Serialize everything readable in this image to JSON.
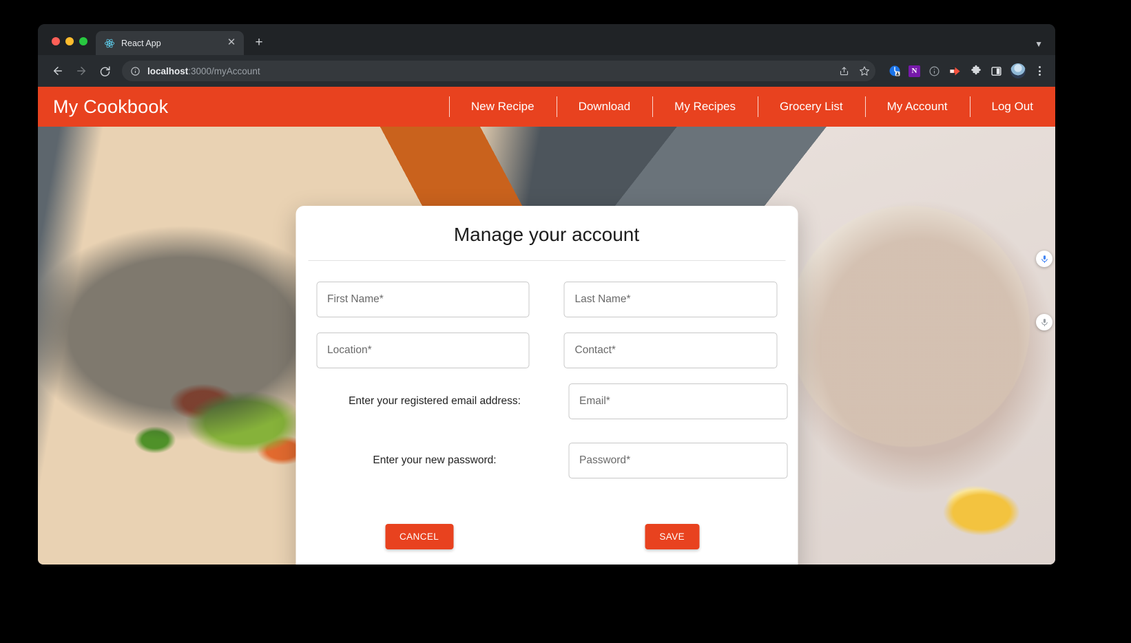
{
  "browser": {
    "tab": {
      "title": "React App",
      "favicon_icon": "react-logo-icon",
      "close_icon": "close-icon"
    },
    "new_tab_label": "+",
    "tabstrip_caret_icon": "chevron-down-icon",
    "back_icon": "arrow-left-icon",
    "forward_icon": "arrow-right-icon",
    "reload_icon": "reload-icon",
    "omnibox": {
      "info_icon": "info-circle-icon",
      "url_host": "localhost",
      "url_path": ":3000/myAccount",
      "share_icon": "share-icon",
      "bookmark_icon": "star-icon"
    },
    "extensions": [
      {
        "name": "extension-blue-badge-icon",
        "label": ""
      },
      {
        "name": "onenote-icon",
        "label": "N"
      },
      {
        "name": "info-circle-icon",
        "label": ""
      },
      {
        "name": "red-arrow-icon",
        "label": ""
      },
      {
        "name": "puzzle-piece-icon",
        "label": ""
      },
      {
        "name": "side-panel-icon",
        "label": ""
      }
    ],
    "avatar_name": "profile-avatar",
    "menu_icon": "kebab-menu-icon"
  },
  "app": {
    "brand": "My Cookbook",
    "nav_links": [
      {
        "label": "New Recipe"
      },
      {
        "label": "Download"
      },
      {
        "label": "My Recipes"
      },
      {
        "label": "Grocery List"
      },
      {
        "label": "My Account"
      },
      {
        "label": "Log Out"
      }
    ],
    "accent_color": "#e8421f"
  },
  "modal": {
    "title": "Manage your account",
    "fields": {
      "first_name": "First Name",
      "last_name": "Last Name",
      "location": "Location",
      "contact": "Contact",
      "email": "Email",
      "password": "Password",
      "required_marker": "*"
    },
    "labels": {
      "email": "Enter your registered email address:",
      "password": "Enter your new password:"
    },
    "buttons": {
      "cancel": "CANCEL",
      "save": "SAVE"
    }
  },
  "overlay": {
    "mic_icon": "microphone-icon"
  }
}
